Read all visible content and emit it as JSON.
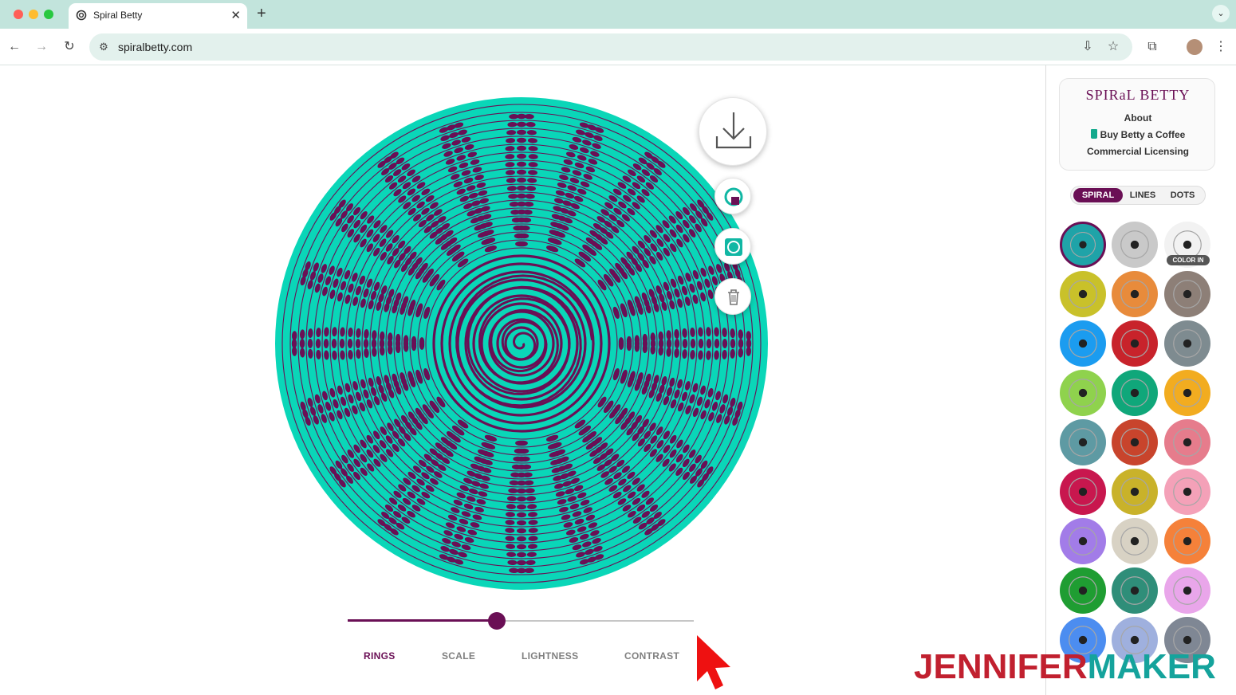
{
  "browser": {
    "tab_title": "Spiral Betty",
    "url": "spiralbetty.com",
    "new_tab_icon": "plus-icon",
    "tab_close_icon": "close-icon"
  },
  "sidebar": {
    "brand": "SPIRaL BETTY",
    "links": [
      "About",
      "Buy Betty a Coffee",
      "Commercial Licensing"
    ],
    "modes": [
      "SPIRAL",
      "LINES",
      "DOTS"
    ],
    "active_mode": "SPIRAL",
    "color_in_badge": "COLOR IN",
    "swatches": [
      [
        "#1fa3a8",
        "#c9c9c9",
        "#f2f2f2"
      ],
      [
        "#c9c12a",
        "#e88b3b",
        "#8d7f77"
      ],
      [
        "#1b9cf0",
        "#c8232b",
        "#7e8b90"
      ],
      [
        "#8fd24d",
        "#10a77a",
        "#f2ac20"
      ],
      [
        "#5e9aa3",
        "#c8442c",
        "#e67c8c"
      ],
      [
        "#c8174e",
        "#c9b22a",
        "#f4a1b8"
      ],
      [
        "#a27ce8",
        "#d8d2c4",
        "#f5813a"
      ],
      [
        "#1f9d32",
        "#2f8e79",
        "#e9a6ea"
      ],
      [
        "#4c8df0",
        "#9fb0de",
        "#7f8794"
      ]
    ]
  },
  "canvas": {
    "fill": "#0ad6b8",
    "ink": "#6a0f55",
    "download_icon": "download-icon",
    "actions": [
      "shuffle-colors-icon",
      "frame-icon",
      "trash-icon"
    ]
  },
  "slider": {
    "labels": [
      "RINGS",
      "SCALE",
      "LIGHTNESS",
      "CONTRAST"
    ],
    "active": "RINGS",
    "value_fraction": 0.43
  },
  "watermark": {
    "part1": "JENNIFER",
    "part2": "MAKER"
  }
}
